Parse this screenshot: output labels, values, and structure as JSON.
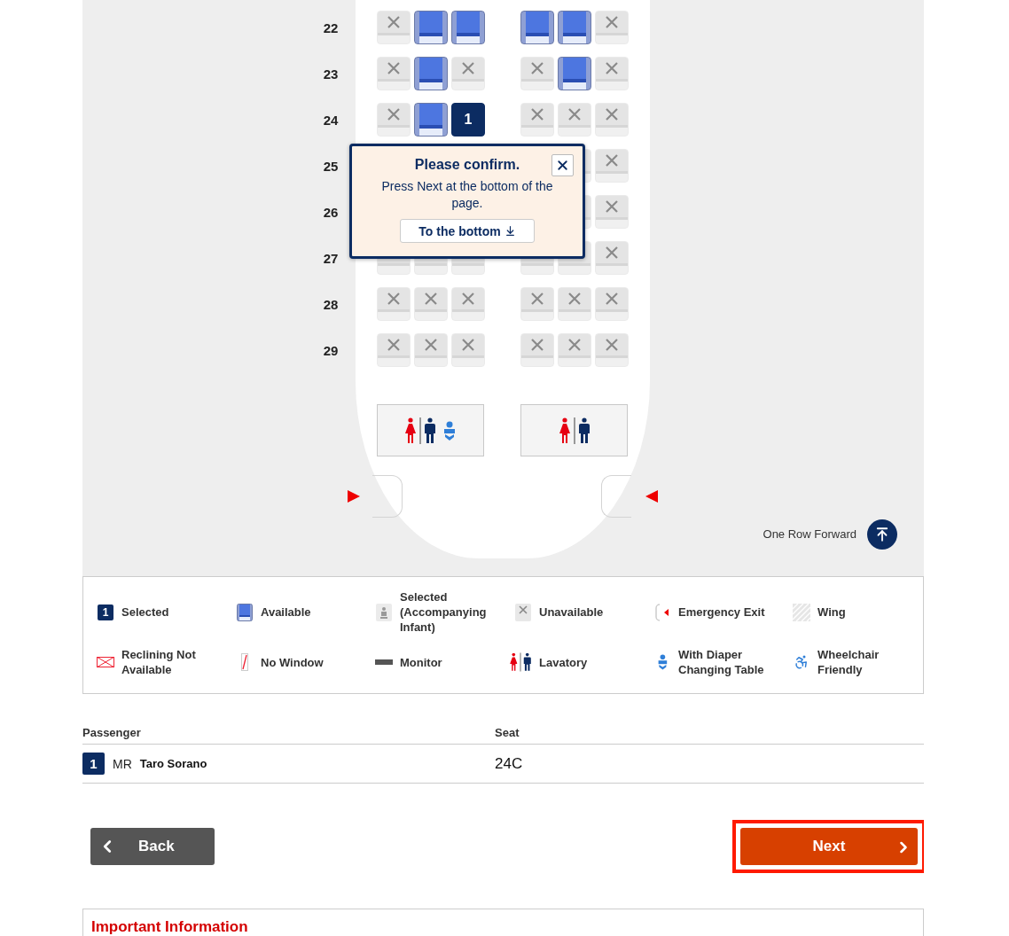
{
  "seat_map": {
    "rows": [
      {
        "number": "22",
        "left": [
          {
            "available": false,
            "selected": false
          },
          {
            "available": true,
            "selected": false
          },
          {
            "available": true,
            "selected": false
          }
        ],
        "right": [
          {
            "available": true,
            "selected": false
          },
          {
            "available": true,
            "selected": false
          },
          {
            "available": false,
            "selected": false
          }
        ]
      },
      {
        "number": "23",
        "left": [
          {
            "available": false,
            "selected": false
          },
          {
            "available": true,
            "selected": false
          },
          {
            "available": false,
            "selected": false
          }
        ],
        "right": [
          {
            "available": false,
            "selected": false
          },
          {
            "available": true,
            "selected": false
          },
          {
            "available": false,
            "selected": false
          }
        ]
      },
      {
        "number": "24",
        "left": [
          {
            "available": false,
            "selected": false
          },
          {
            "available": true,
            "selected": false
          },
          {
            "selected": true,
            "label": "1"
          }
        ],
        "right": [
          {
            "available": false,
            "selected": false
          },
          {
            "available": false,
            "selected": false
          },
          {
            "available": false,
            "selected": false
          }
        ]
      },
      {
        "number": "25",
        "right": [
          {
            "available": false,
            "selected": false
          },
          {
            "available": false,
            "selected": false
          }
        ]
      },
      {
        "number": "26",
        "right": [
          {
            "available": false,
            "selected": false
          },
          {
            "available": false,
            "selected": false
          }
        ]
      },
      {
        "number": "27",
        "left": [
          {
            "available": false,
            "selected": false
          },
          {
            "available": false,
            "selected": false
          },
          {
            "available": false,
            "selected": false
          }
        ],
        "right": [
          {
            "available": false,
            "selected": false
          },
          {
            "available": false,
            "selected": false
          },
          {
            "available": false,
            "selected": false
          }
        ]
      },
      {
        "number": "28",
        "left": [
          {
            "available": false,
            "selected": false
          },
          {
            "available": false,
            "selected": false
          },
          {
            "available": false,
            "selected": false
          }
        ],
        "right": [
          {
            "available": false,
            "selected": false
          },
          {
            "available": false,
            "selected": false
          },
          {
            "available": false,
            "selected": false
          }
        ]
      },
      {
        "number": "29",
        "left": [
          {
            "available": false,
            "selected": false
          },
          {
            "available": false,
            "selected": false
          },
          {
            "available": false,
            "selected": false
          }
        ],
        "right": [
          {
            "available": false,
            "selected": false
          },
          {
            "available": false,
            "selected": false
          },
          {
            "available": false,
            "selected": false
          }
        ]
      }
    ],
    "lavatories": [
      {
        "diaper_table": true
      },
      {
        "diaper_table": false
      }
    ],
    "popup": {
      "title": "Please confirm.",
      "message": "Press Next at the bottom of the page.",
      "button": "To the bottom"
    },
    "one_row_forward": "One Row Forward"
  },
  "legend": [
    {
      "kind": "selected",
      "label": "Selected",
      "badge": "1"
    },
    {
      "kind": "available",
      "label": "Available"
    },
    {
      "kind": "infant",
      "label": "Selected (Accompanying Infant)"
    },
    {
      "kind": "unavailable",
      "label": "Unavailable"
    },
    {
      "kind": "exit",
      "label": "Emergency Exit"
    },
    {
      "kind": "wing",
      "label": "Wing"
    },
    {
      "kind": "no_recline",
      "label": "Reclining Not Available"
    },
    {
      "kind": "no_window",
      "label": "No Window"
    },
    {
      "kind": "monitor",
      "label": "Monitor"
    },
    {
      "kind": "lavatory",
      "label": "Lavatory"
    },
    {
      "kind": "diaper",
      "label": "With Diaper Changing Table"
    },
    {
      "kind": "wheelchair",
      "label": "Wheelchair Friendly"
    }
  ],
  "passengers": {
    "columns": [
      "Passenger",
      "Seat"
    ],
    "rows": [
      {
        "number": "1",
        "title": "MR",
        "name": "Taro Sorano",
        "seat": "24C"
      }
    ]
  },
  "buttons": {
    "back": "Back",
    "next": {
      "label": "Next",
      "highlighted": true
    }
  },
  "important_information": {
    "title": "Important Information"
  }
}
